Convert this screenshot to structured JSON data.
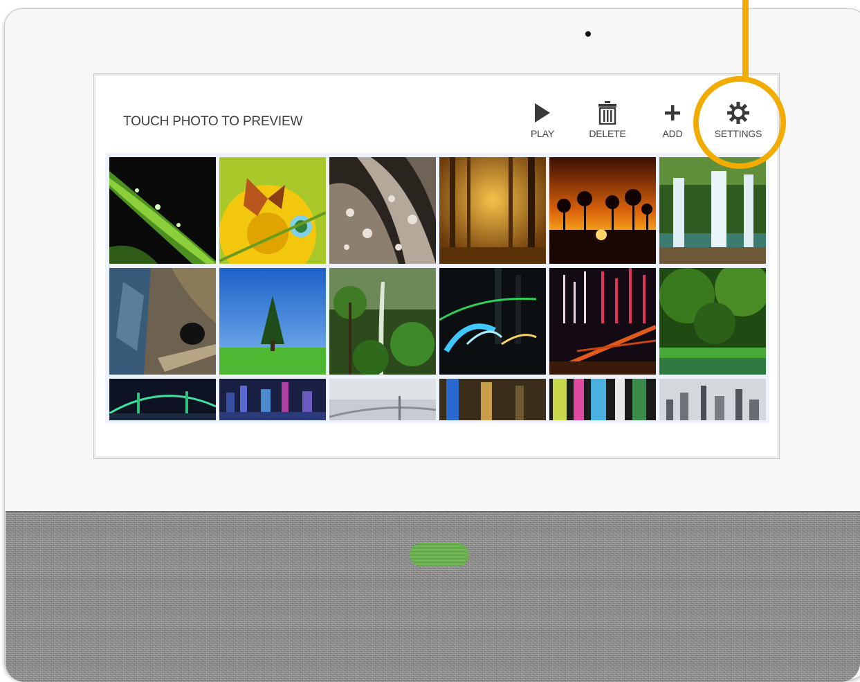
{
  "screen": {
    "title": "TOUCH PHOTO TO PREVIEW"
  },
  "toolbar": {
    "play": {
      "label": "PLAY",
      "icon": "play-icon"
    },
    "delete": {
      "label": "DELETE",
      "icon": "trash-icon"
    },
    "add": {
      "label": "ADD",
      "icon": "plus-icon"
    },
    "settings": {
      "label": "SETTINGS",
      "icon": "gear-icon"
    }
  },
  "photos": [
    "grass-dewdrops",
    "butterfly-dandelion",
    "water-droplets-leaves",
    "misty-forest",
    "palm-sunset",
    "waterfall",
    "tunnel-canyon",
    "lone-tree-meadow",
    "rainforest",
    "light-trails",
    "fireworks-bridge",
    "green-lake-forest",
    "night-bridge",
    "city-skyline-night",
    "bridge-clouds",
    "tower-night",
    "neon-street",
    "city-aerial"
  ],
  "colors": {
    "accent": "#f2ab00",
    "home_button": "#64b347",
    "text": "#3d3d3d"
  }
}
